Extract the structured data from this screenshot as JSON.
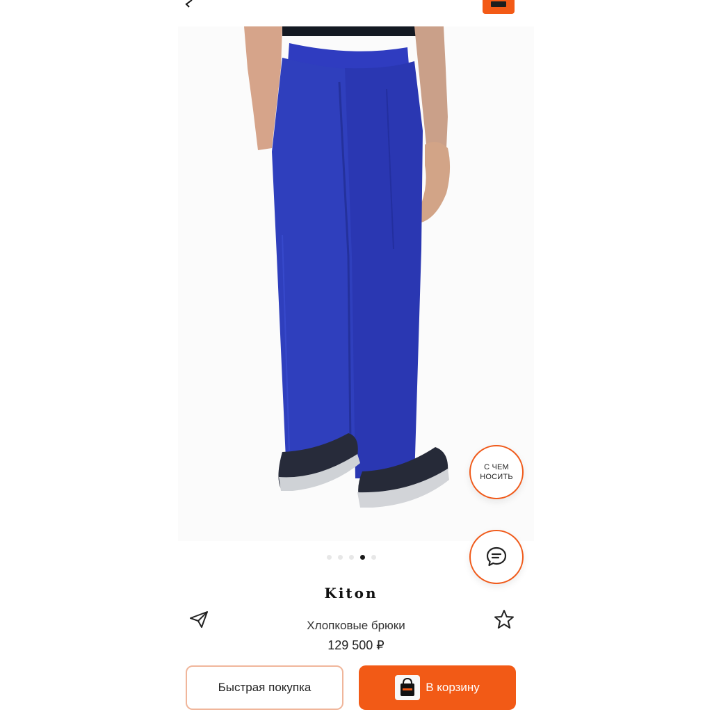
{
  "header": {
    "back_icon": "chevron-left-icon",
    "cart_icon": "cart-icon"
  },
  "gallery": {
    "image_description": "product-photo",
    "slide_count": 5,
    "active_slide": 4
  },
  "fabs": {
    "wear_with_label_line1": "С ЧЕМ",
    "wear_with_label_line2": "НОСИТЬ",
    "chat_icon": "chat-icon"
  },
  "product": {
    "brand": "Kiton",
    "name": "Хлопковые брюки",
    "price": "129 500 ₽"
  },
  "actions": {
    "quick_buy": "Быстрая покупка",
    "add_to_cart": "В корзину",
    "share_icon": "send-icon",
    "favorite_icon": "star-icon"
  },
  "colors": {
    "accent": "#f25a16",
    "trousers": "#2d3fb7"
  }
}
